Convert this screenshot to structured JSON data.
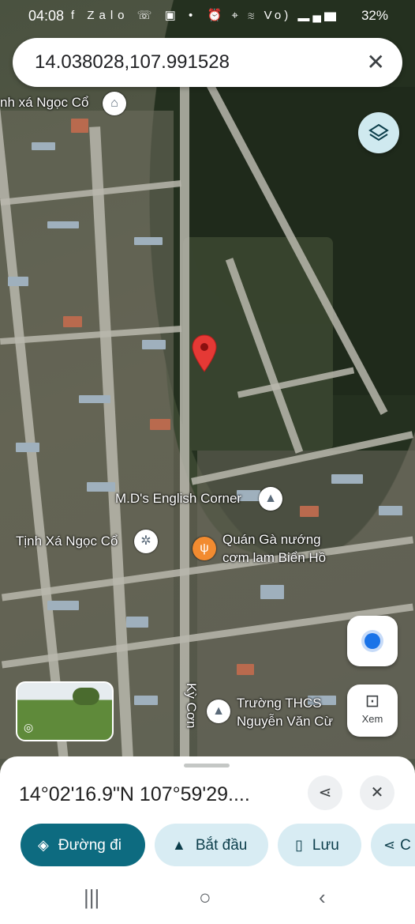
{
  "status_bar": {
    "time": "04:08",
    "left_icons": "f Zalo ☏ ▣ •",
    "right_icons": "⏰ ⌖ ≋ Vo) ▂▄▆",
    "battery": "32%"
  },
  "search": {
    "query": "14.038028,107.991528",
    "clear_icon": "close-icon"
  },
  "map": {
    "type": "satellite",
    "labels": {
      "top_poi": "nh xá Ngọc Cổ",
      "english_corner": "M.D's English Corner",
      "tinh_xa": "Tịnh Xá Ngọc Cổ",
      "restaurant_line1": "Quán Gà nướng",
      "restaurant_line2": "cơm lam Biển Hồ",
      "school_line1": "Trường THCS",
      "school_line2": "Nguyễn Văn Cừ",
      "street": "Kỳ Cơn"
    }
  },
  "buttons": {
    "lens_label": "Xem"
  },
  "sheet": {
    "coordinates": "14°02'16.9\"N 107°59'29....",
    "actions": [
      {
        "label": "Đường đi",
        "icon": "directions-icon"
      },
      {
        "label": "Bắt đầu",
        "icon": "navigation-arrow-icon"
      },
      {
        "label": "Lưu",
        "icon": "bookmark-icon"
      },
      {
        "label": "C",
        "icon": "share-icon"
      }
    ]
  },
  "colors": {
    "primary": "#0d6b80",
    "chip": "#d8ecf3",
    "pin": "#e53935",
    "location": "#1a73e8"
  }
}
